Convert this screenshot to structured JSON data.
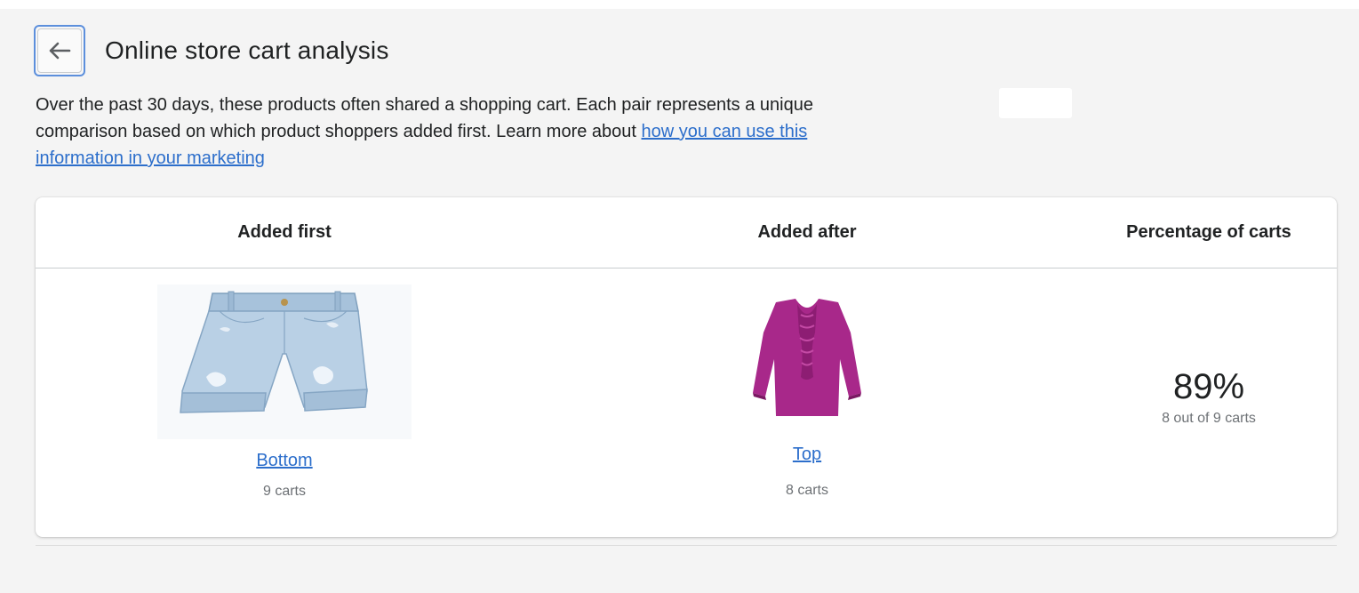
{
  "header": {
    "back_icon": "arrow-left-icon",
    "title": "Online store cart analysis"
  },
  "description": {
    "text": "Over the past 30 days, these products often shared a shopping cart. Each pair represents a unique comparison based on which product shoppers added first. Learn more about ",
    "link_text": "how you can use this information in your marketing"
  },
  "table": {
    "columns": [
      "Added first",
      "Added after",
      "Percentage of carts"
    ],
    "rows": [
      {
        "first": {
          "name": "Bottom",
          "image": "denim-shorts-image",
          "carts": "9 carts"
        },
        "after": {
          "name": "Top",
          "image": "purple-blouse-image",
          "carts": "8 carts"
        },
        "percentage": "89%",
        "percentage_detail": "8 out of 9 carts"
      }
    ]
  },
  "colors": {
    "link": "#2c6ecb",
    "focus_ring": "#5c8fdc",
    "background": "#f4f4f4",
    "blouse": "#a8288a",
    "denim": "#a9c4dc"
  }
}
